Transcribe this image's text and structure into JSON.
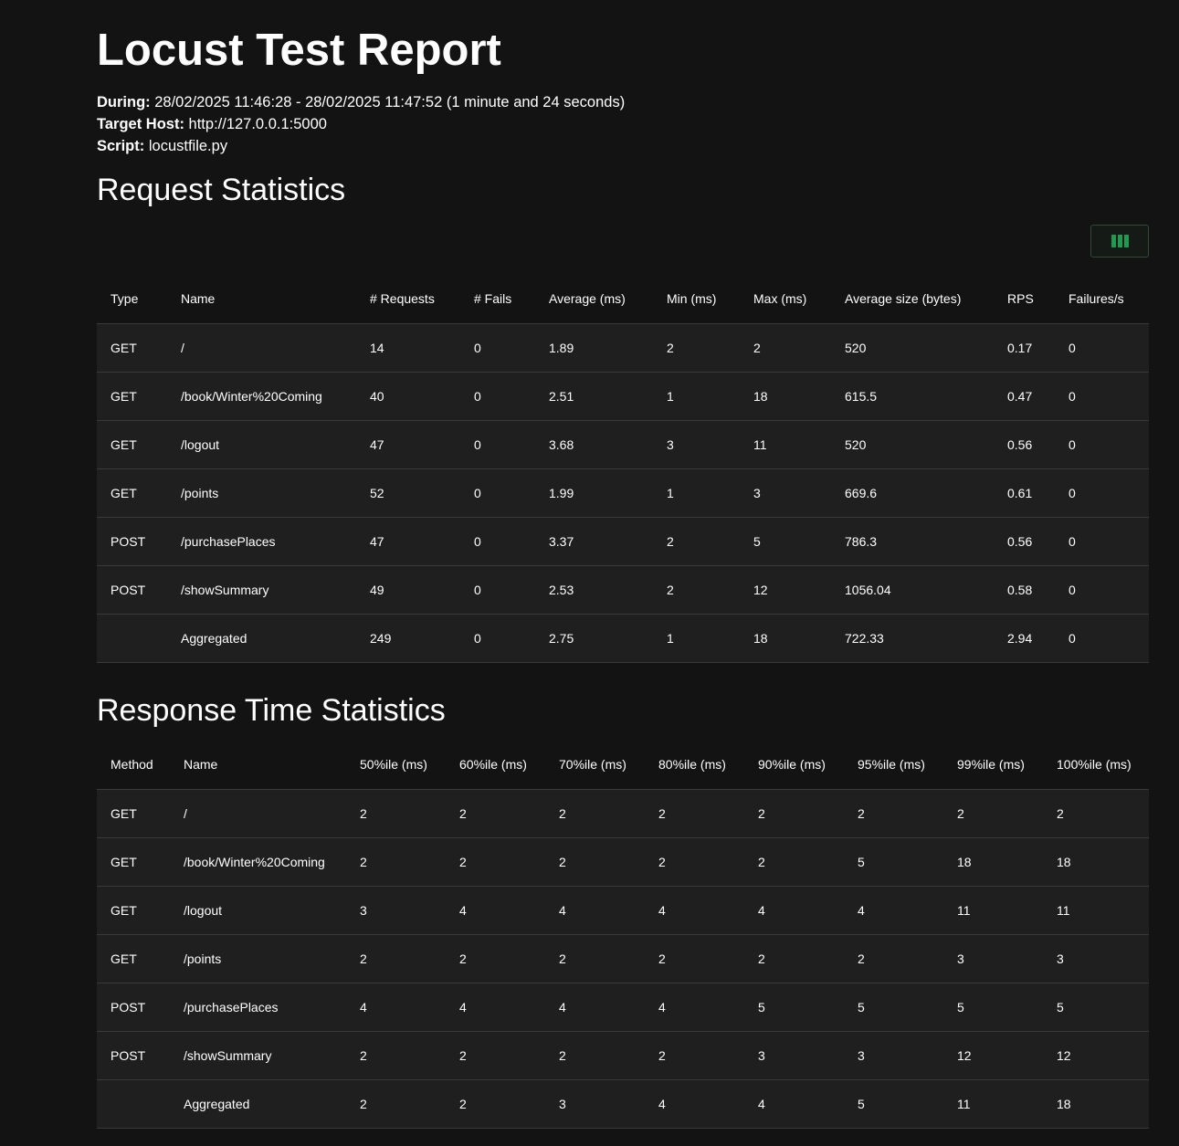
{
  "report": {
    "title": "Locust Test Report",
    "during_label": "During:",
    "during_value": "28/02/2025 11:46:28 - 28/02/2025 11:47:52 (1 minute and 24 seconds)",
    "host_label": "Target Host:",
    "host_value": "http://127.0.0.1:5000",
    "script_label": "Script:",
    "script_value": "locustfile.py"
  },
  "request_stats": {
    "heading": "Request Statistics",
    "column_toggle_icon": "columns-icon",
    "accent_color": "#1f9a4e",
    "headers": [
      "Type",
      "Name",
      "# Requests",
      "# Fails",
      "Average (ms)",
      "Min (ms)",
      "Max (ms)",
      "Average size (bytes)",
      "RPS",
      "Failures/s"
    ],
    "rows": [
      [
        "GET",
        "/",
        "14",
        "0",
        "1.89",
        "2",
        "2",
        "520",
        "0.17",
        "0"
      ],
      [
        "GET",
        "/book/Winter%20Coming",
        "40",
        "0",
        "2.51",
        "1",
        "18",
        "615.5",
        "0.47",
        "0"
      ],
      [
        "GET",
        "/logout",
        "47",
        "0",
        "3.68",
        "3",
        "11",
        "520",
        "0.56",
        "0"
      ],
      [
        "GET",
        "/points",
        "52",
        "0",
        "1.99",
        "1",
        "3",
        "669.6",
        "0.61",
        "0"
      ],
      [
        "POST",
        "/purchasePlaces",
        "47",
        "0",
        "3.37",
        "2",
        "5",
        "786.3",
        "0.56",
        "0"
      ],
      [
        "POST",
        "/showSummary",
        "49",
        "0",
        "2.53",
        "2",
        "12",
        "1056.04",
        "0.58",
        "0"
      ],
      [
        "",
        "Aggregated",
        "249",
        "0",
        "2.75",
        "1",
        "18",
        "722.33",
        "2.94",
        "0"
      ]
    ]
  },
  "response_stats": {
    "heading": "Response Time Statistics",
    "headers": [
      "Method",
      "Name",
      "50%ile (ms)",
      "60%ile (ms)",
      "70%ile (ms)",
      "80%ile (ms)",
      "90%ile (ms)",
      "95%ile (ms)",
      "99%ile (ms)",
      "100%ile (ms)"
    ],
    "rows": [
      [
        "GET",
        "/",
        "2",
        "2",
        "2",
        "2",
        "2",
        "2",
        "2",
        "2"
      ],
      [
        "GET",
        "/book/Winter%20Coming",
        "2",
        "2",
        "2",
        "2",
        "2",
        "5",
        "18",
        "18"
      ],
      [
        "GET",
        "/logout",
        "3",
        "4",
        "4",
        "4",
        "4",
        "4",
        "11",
        "11"
      ],
      [
        "GET",
        "/points",
        "2",
        "2",
        "2",
        "2",
        "2",
        "2",
        "3",
        "3"
      ],
      [
        "POST",
        "/purchasePlaces",
        "4",
        "4",
        "4",
        "4",
        "5",
        "5",
        "5",
        "5"
      ],
      [
        "POST",
        "/showSummary",
        "2",
        "2",
        "2",
        "2",
        "3",
        "3",
        "12",
        "12"
      ],
      [
        "",
        "Aggregated",
        "2",
        "2",
        "3",
        "4",
        "4",
        "5",
        "11",
        "18"
      ]
    ]
  }
}
